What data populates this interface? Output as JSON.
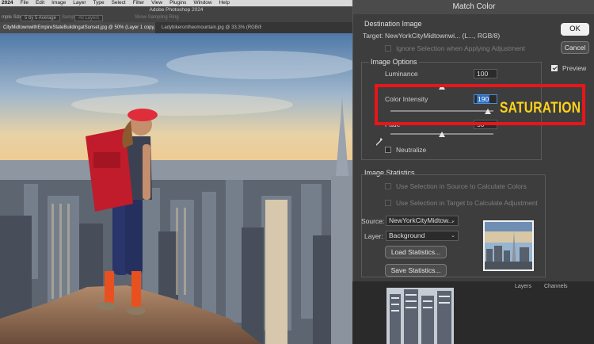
{
  "menubar": {
    "app": "2024",
    "items": [
      "File",
      "Edit",
      "Image",
      "Layer",
      "Type",
      "Select",
      "Filter",
      "View",
      "Plugins",
      "Window",
      "Help"
    ]
  },
  "options_bar": {
    "app_title": "Adobe Photoshop 2024",
    "sample_size_label": "mple Size:",
    "sample_size_value": "5 by 5 Average",
    "sample_label": "Sample:",
    "sample_value": "All Layers",
    "show_ring": "Show Sampling Ring"
  },
  "document_tabs": [
    {
      "label": "CityMidtownwithEmpireStateBuildingatSunset.jpg @ 50% (Layer 1 copy, RGB/8#) *",
      "active": true
    },
    {
      "label": "Ladybikerontheomountain.jpg @ 33.3% (RGB/8)",
      "active": false
    }
  ],
  "dialog": {
    "title": "Match Color",
    "destination": {
      "heading": "Destination Image",
      "target_label": "Target:",
      "target_value": "NewYorkCityMidtownwi... (L..., RGB/8)",
      "ignore_selection": "Ignore Selection when Applying Adjustment"
    },
    "image_options": {
      "heading": "Image Options",
      "luminance_label": "Luminance",
      "luminance_value": "100",
      "luminance_level": 100,
      "color_intensity_label": "Color Intensity",
      "color_intensity_value": "190",
      "color_intensity_level": 190,
      "fade_label": "Fade",
      "fade_value": "50",
      "fade_level": 50,
      "neutralize_label": "Neutralize"
    },
    "image_statistics": {
      "heading": "Image Statistics",
      "use_selection_source": "Use Selection in Source to Calculate Colors",
      "use_selection_target": "Use Selection in Target to Calculate Adjustment",
      "source_label": "Source:",
      "source_value": "NewYorkCityMidtow...",
      "layer_label": "Layer:",
      "layer_value": "Background",
      "load_button": "Load Statistics...",
      "save_button": "Save Statistics..."
    },
    "buttons": {
      "ok": "OK",
      "cancel": "Cancel",
      "preview": "Preview",
      "preview_checked": true
    }
  },
  "annotation": {
    "text": "SATURATION",
    "color": "#ffd21a",
    "box_color": "#e8161b"
  },
  "panels": {
    "layers_tabs": [
      "Layers",
      "Channels"
    ]
  },
  "colors": {
    "dialog_bg": "#3d3d3d",
    "accent_blue": "#2f6fc4"
  }
}
